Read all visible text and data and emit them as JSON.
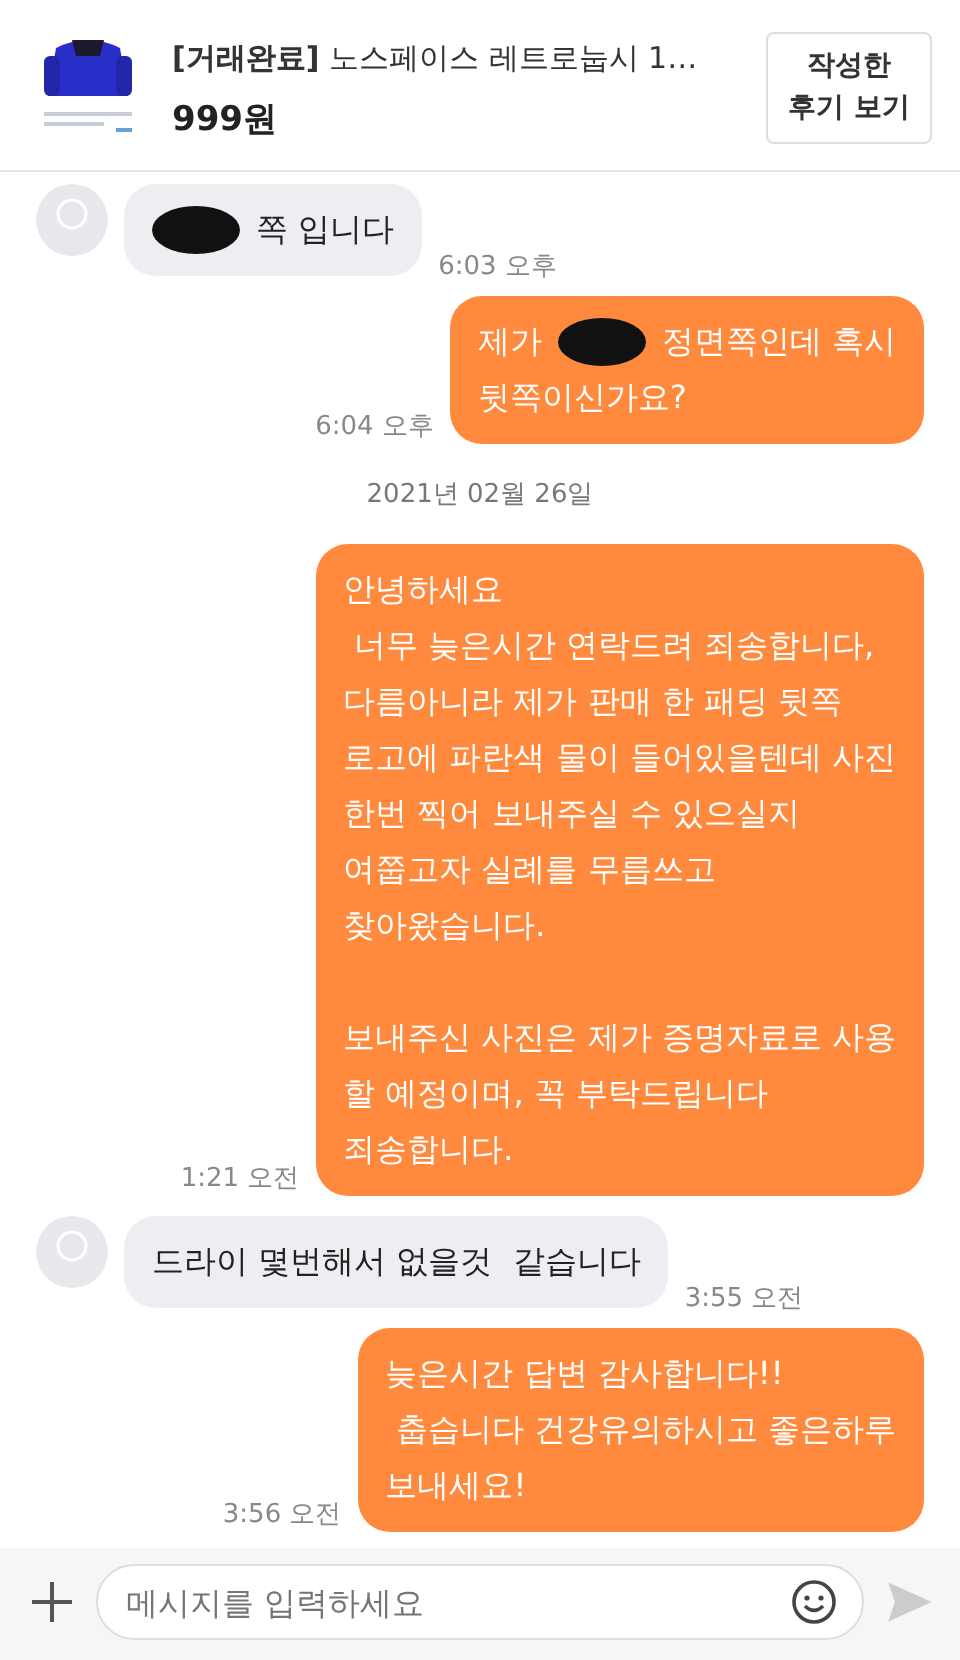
{
  "header": {
    "title": "**[거래완료]** 노스페이스 레트로눕시 1…",
    "price": "999원",
    "review_button": "작성한\n후기 보기"
  },
  "messages": [
    {
      "kind": "received",
      "lines": [
        [
          {
            "kind": "redaction"
          },
          {
            "kind": "text",
            "text": "쪽 입니다"
          }
        ]
      ],
      "time": "6:03 오후"
    },
    {
      "kind": "sent",
      "lines": [
        [
          {
            "kind": "text",
            "text": "제가"
          },
          {
            "kind": "redaction"
          },
          {
            "kind": "text",
            "text": "정면쪽인데 혹시"
          }
        ],
        [
          {
            "kind": "text",
            "text": "뒷쪽이신가요?"
          }
        ]
      ],
      "time": "6:04 오후"
    },
    {
      "kind": "date",
      "text": "2021년 02월 26일"
    },
    {
      "kind": "sent",
      "lines": [
        [
          {
            "kind": "text",
            "text": "안녕하세요\n 너무 늦은시간 연락드려 죄송합니다,\n다름아니라 제가 판매 한 패딩 뒷쪽\n로고에 파란색 물이 들어있을텐데 사진\n한번 찍어 보내주실 수 있으실지\n여쭙고자 실례를 무릅쓰고\n찾아왔습니다.\n\n보내주신 사진은 제가 증명자료로 사용\n할 예정이며, 꼭 부탁드립니다\n죄송합니다."
          }
        ]
      ],
      "time": "1:21 오전"
    },
    {
      "kind": "received",
      "lines": [
        [
          {
            "kind": "text",
            "text": "드라이 몇번해서 없을것  같습니다"
          }
        ]
      ],
      "time": "3:55 오전"
    },
    {
      "kind": "sent",
      "lines": [
        [
          {
            "kind": "text",
            "text": "늦은시간 답변 감사합니다!!\n 춥습니다 건강유의하시고 좋은하루\n보내세요!"
          }
        ]
      ],
      "time": "3:56 오전"
    }
  ],
  "composer": {
    "placeholder": "메시지를 입력하세요",
    "send_disabled": true
  }
}
